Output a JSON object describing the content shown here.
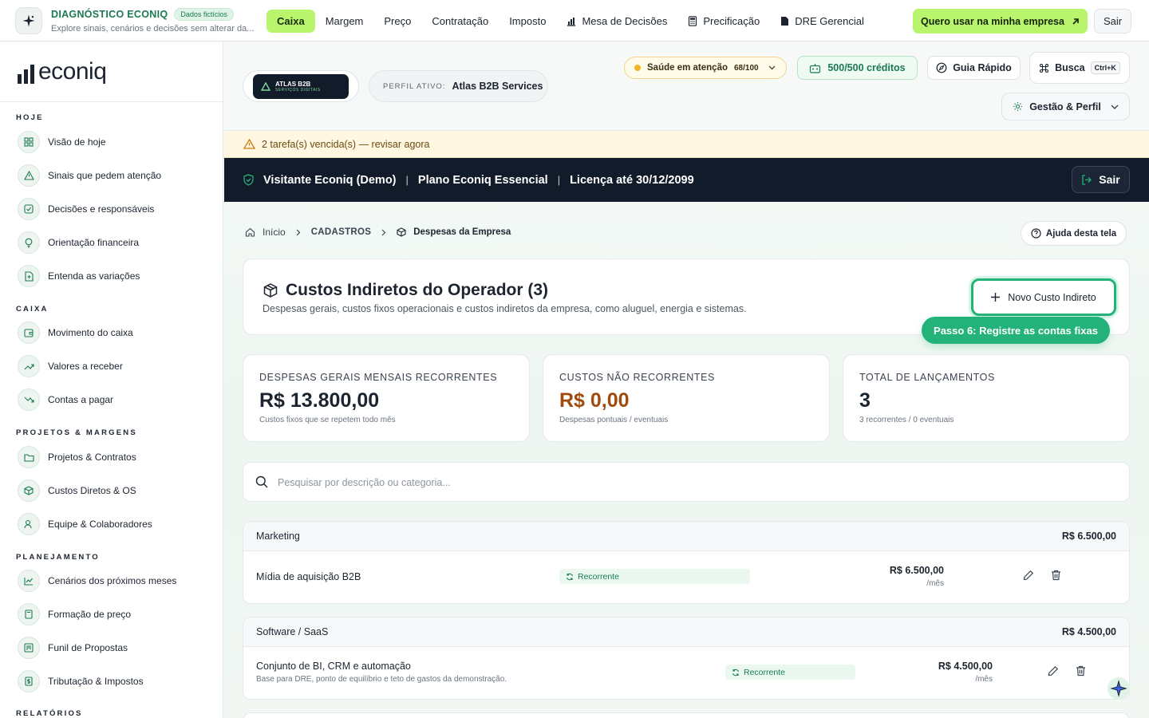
{
  "topbar": {
    "title": "DIAGNÓSTICO ECONIQ",
    "badge": "Dados fictícios",
    "subtitle": "Explore sinais, cenários e decisões sem alterar da...",
    "nav": [
      {
        "label": "Caixa",
        "active": true
      },
      {
        "label": "Margem"
      },
      {
        "label": "Preço"
      },
      {
        "label": "Contratação"
      },
      {
        "label": "Imposto"
      },
      {
        "label": "Mesa de Decisões",
        "icon": "chart-icon"
      },
      {
        "label": "Precificação",
        "icon": "calculator-icon"
      },
      {
        "label": "DRE Gerencial",
        "icon": "document-icon"
      }
    ],
    "cta_label": "Quero usar na minha empresa",
    "exit_label": "Sair"
  },
  "sidebar": {
    "logo_text": "econiq",
    "sections": [
      {
        "title": "HOJE",
        "items": [
          {
            "label": "Visão de hoje",
            "icon": "grid-icon"
          },
          {
            "label": "Sinais que pedem atenção",
            "icon": "warning-icon"
          },
          {
            "label": "Decisões e responsáveis",
            "icon": "checkbox-icon"
          },
          {
            "label": "Orientação financeira",
            "icon": "lightbulb-icon"
          },
          {
            "label": "Entenda as variações",
            "icon": "file-diff-icon"
          }
        ]
      },
      {
        "title": "CAIXA",
        "items": [
          {
            "label": "Movimento do caixa",
            "icon": "wallet-icon"
          },
          {
            "label": "Valores a receber",
            "icon": "trend-up-icon"
          },
          {
            "label": "Contas a pagar",
            "icon": "trend-down-icon"
          }
        ]
      },
      {
        "title": "PROJETOS & MARGENS",
        "items": [
          {
            "label": "Projetos & Contratos",
            "icon": "folder-icon"
          },
          {
            "label": "Custos Diretos & OS",
            "icon": "box-icon"
          },
          {
            "label": "Equipe & Colaboradores",
            "icon": "user-icon"
          }
        ]
      },
      {
        "title": "PLANEJAMENTO",
        "items": [
          {
            "label": "Cenários dos próximos meses",
            "icon": "line-chart-icon"
          },
          {
            "label": "Formação de preço",
            "icon": "calculator-icon"
          },
          {
            "label": "Funil de Propostas",
            "icon": "kanban-icon"
          },
          {
            "label": "Tributação & Impostos",
            "icon": "receipt-icon"
          }
        ]
      },
      {
        "title": "RELATÓRIOS",
        "items": []
      }
    ]
  },
  "header": {
    "company_logo_title": "ATLAS B2B",
    "company_logo_sub": "SERVIÇOS DIGITAIS",
    "profile_label": "PERFIL ATIVO:",
    "profile_value": "Atlas B2B Services",
    "health_label": "Saúde em atenção",
    "health_score": "68/100",
    "health_color": "#f2b321",
    "credits_label": "500/500 créditos",
    "guide_label": "Guia Rápido",
    "search_label": "Busca",
    "search_shortcut": "Ctrl+K",
    "management_label": "Gestão & Perfil"
  },
  "alert": {
    "text": "2 tarefa(s) vencida(s) — revisar agora"
  },
  "userbar": {
    "user": "Visitante Econiq (Demo)",
    "plan": "Plano Econiq Essencial",
    "license": "Licença até 30/12/2099",
    "exit_label": "Sair",
    "separator": "|"
  },
  "breadcrumb": {
    "home": "Início",
    "section": "CADASTROS",
    "current": "Despesas da Empresa",
    "help_label": "Ajuda desta tela"
  },
  "page": {
    "title": "Custos Indiretos do Operador (3)",
    "description": "Despesas gerais, custos fixos operacionais e custos indiretos da empresa, como aluguel, energia e sistemas.",
    "new_button_label": "Novo Custo Indireto",
    "step_tip": "Passo 6: Registre as contas fixas"
  },
  "kpis": [
    {
      "label": "DESPESAS GERAIS MENSAIS RECORRENTES",
      "value": "R$ 13.800,00",
      "note": "Custos fixos que se repetem todo mês",
      "color": "#1c2430"
    },
    {
      "label": "CUSTOS NÃO RECORRENTES",
      "value": "R$ 0,00",
      "note": "Despesas pontuais / eventuais",
      "color": "#a04a0e"
    },
    {
      "label": "TOTAL DE LANÇAMENTOS",
      "value": "3",
      "note": "3 recorrentes / 0 eventuais",
      "color": "#1c2430"
    }
  ],
  "search": {
    "placeholder": "Pesquisar por descrição ou categoria..."
  },
  "groups": [
    {
      "name": "Marketing",
      "total": "R$ 6.500,00",
      "rows": [
        {
          "name": "Mídia de aquisição B2B",
          "tag": "Recorrente",
          "amount": "R$ 6.500,00",
          "unit": "/mês"
        }
      ]
    },
    {
      "name": "Software / SaaS",
      "total": "R$ 4.500,00",
      "rows": [
        {
          "name": "Conjunto de BI, CRM e automação",
          "sub": "Base para DRE, ponto de equilíbrio e teto de gastos da demonstração.",
          "tag": "Recorrente",
          "amount": "R$ 4.500,00",
          "unit": "/mês"
        }
      ]
    }
  ],
  "colors": {
    "accent": "#23b37a",
    "lime": "#b8f56d",
    "dark": "#121b29"
  }
}
